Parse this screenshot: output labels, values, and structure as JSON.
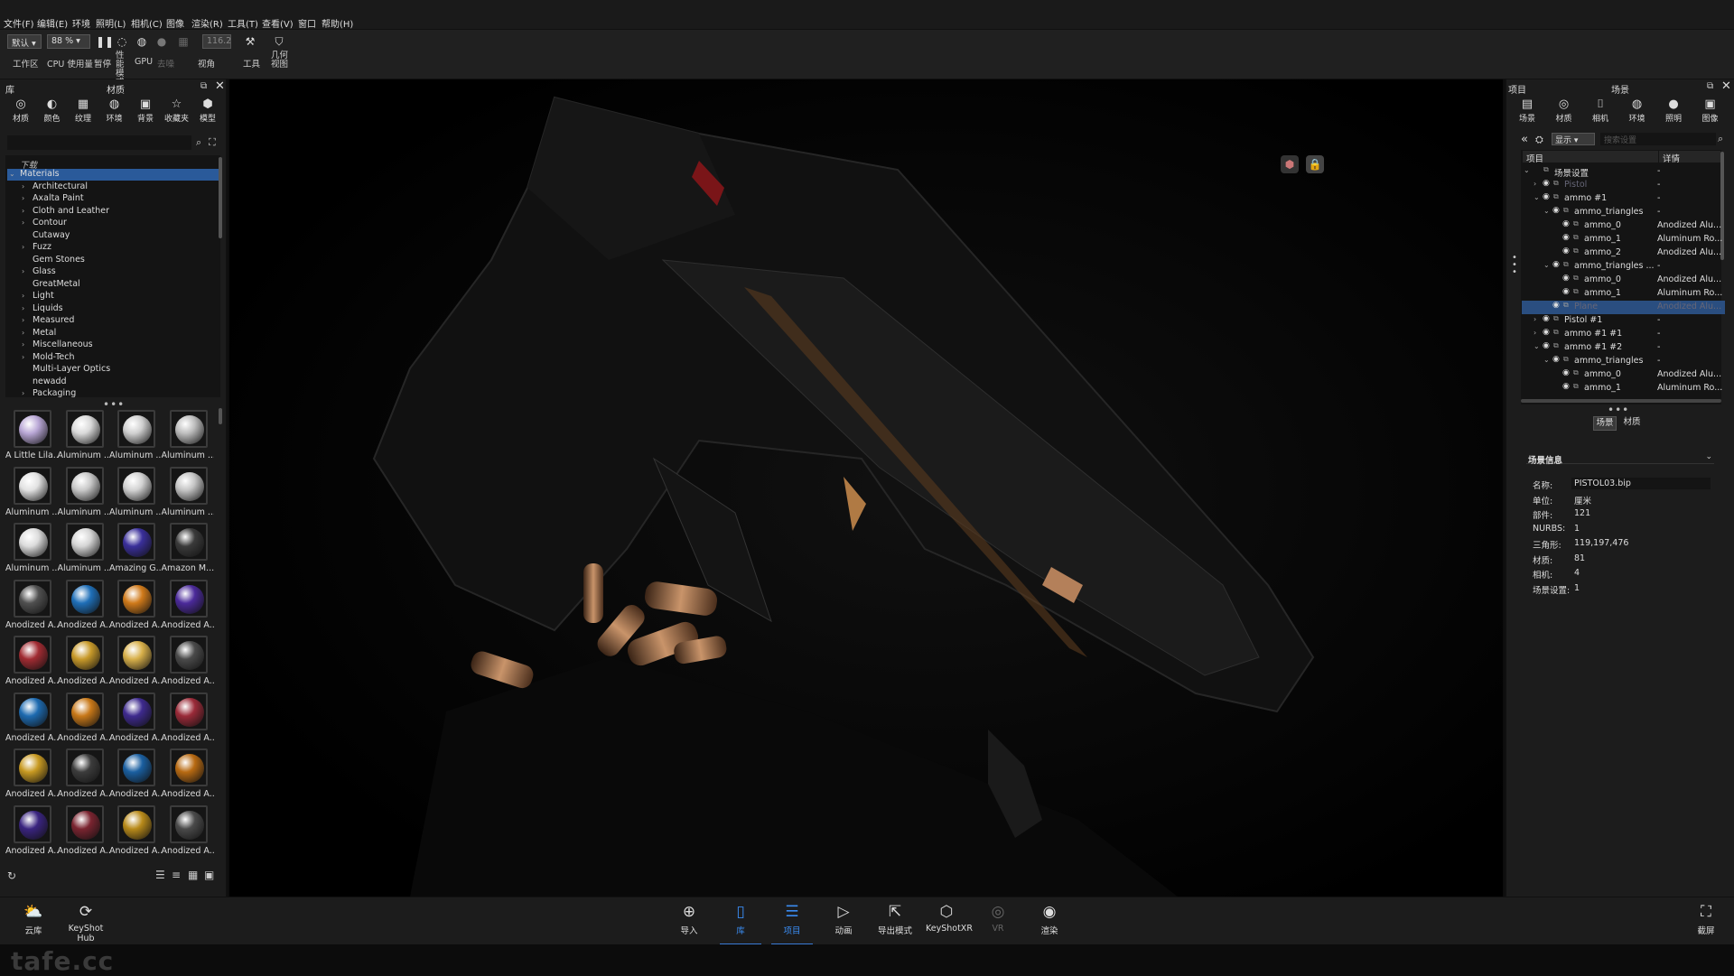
{
  "menu": [
    "文件(F)",
    "编辑(E)",
    "环境",
    "照明(L)",
    "相机(C)",
    "图像",
    "渲染(R)",
    "工具(T)",
    "查看(V)",
    "窗口",
    "帮助(H)"
  ],
  "toolbar": {
    "workspace_value": "默认",
    "zoom_value": "88 %",
    "render_value": "116.2",
    "labels": {
      "workspace": "工作区",
      "cpu": "CPU 使用量",
      "pause": "暂停",
      "perf": "性能模式",
      "gpu": "GPU",
      "denoise": "去噪",
      "view": "视角",
      "tools": "工具",
      "geometry": "几何视图"
    }
  },
  "library": {
    "title_left": "库",
    "title": "材质",
    "tabs": [
      "材质",
      "颜色",
      "纹理",
      "环境",
      "背景",
      "收藏夹",
      "模型"
    ],
    "tabs_icons": [
      "material-icon",
      "color-icon",
      "texture-icon",
      "environment-icon",
      "background-icon",
      "favorites-icon",
      "model-icon"
    ],
    "tree_header": "下载",
    "tree": [
      {
        "label": "Materials",
        "arrow": "v",
        "indent": 0,
        "selected": true
      },
      {
        "label": "Architectural",
        "arrow": ">",
        "indent": 1
      },
      {
        "label": "Axalta Paint",
        "arrow": ">",
        "indent": 1
      },
      {
        "label": "Cloth and Leather",
        "arrow": ">",
        "indent": 1
      },
      {
        "label": "Contour",
        "arrow": ">",
        "indent": 1
      },
      {
        "label": "Cutaway",
        "arrow": "",
        "indent": 1
      },
      {
        "label": "Fuzz",
        "arrow": ">",
        "indent": 1
      },
      {
        "label": "Gem Stones",
        "arrow": "",
        "indent": 1
      },
      {
        "label": "Glass",
        "arrow": ">",
        "indent": 1
      },
      {
        "label": "GreatMetal",
        "arrow": "",
        "indent": 1
      },
      {
        "label": "Light",
        "arrow": ">",
        "indent": 1
      },
      {
        "label": "Liquids",
        "arrow": ">",
        "indent": 1
      },
      {
        "label": "Measured",
        "arrow": ">",
        "indent": 1
      },
      {
        "label": "Metal",
        "arrow": ">",
        "indent": 1
      },
      {
        "label": "Miscellaneous",
        "arrow": ">",
        "indent": 1
      },
      {
        "label": "Mold-Tech",
        "arrow": ">",
        "indent": 1
      },
      {
        "label": "Multi-Layer Optics",
        "arrow": "",
        "indent": 1
      },
      {
        "label": "newadd",
        "arrow": "",
        "indent": 1
      },
      {
        "label": "Packaging",
        "arrow": ">",
        "indent": 1
      }
    ],
    "materials": [
      {
        "label": "A Little Lila...",
        "color": "#b9a7d6"
      },
      {
        "label": "Aluminum ...",
        "color": "#d9d9d9"
      },
      {
        "label": "Aluminum ...",
        "color": "#cfcfcf"
      },
      {
        "label": "Aluminum ...",
        "color": "#bdbdbd"
      },
      {
        "label": "Aluminum ...",
        "color": "#e2e2e2"
      },
      {
        "label": "Aluminum ...",
        "color": "#c8c8c8"
      },
      {
        "label": "Aluminum ...",
        "color": "#d2d2d2"
      },
      {
        "label": "Aluminum ...",
        "color": "#c4c4c4"
      },
      {
        "label": "Aluminum ...",
        "color": "#dcdcdc"
      },
      {
        "label": "Aluminum ...",
        "color": "#d5d5d5"
      },
      {
        "label": "Amazing G...",
        "color": "#3a2f9a"
      },
      {
        "label": "Amazon M...",
        "color": "#3a3a3a"
      },
      {
        "label": "Anodized A...",
        "color": "#505050"
      },
      {
        "label": "Anodized A...",
        "color": "#1f6fb8"
      },
      {
        "label": "Anodized A...",
        "color": "#d07a1a"
      },
      {
        "label": "Anodized A...",
        "color": "#4b2a9a"
      },
      {
        "label": "Anodized A...",
        "color": "#a12b32"
      },
      {
        "label": "Anodized A...",
        "color": "#c89a2a"
      },
      {
        "label": "Anodized A...",
        "color": "#d8b04a"
      },
      {
        "label": "Anodized A...",
        "color": "#4a4a4a"
      },
      {
        "label": "Anodized A...",
        "color": "#1d6ab0"
      },
      {
        "label": "Anodized A...",
        "color": "#c87818"
      },
      {
        "label": "Anodized A...",
        "color": "#3e2a8e"
      },
      {
        "label": "Anodized A...",
        "color": "#9a2a38"
      },
      {
        "label": "Anodized A...",
        "color": "#c89a22"
      },
      {
        "label": "Anodized A...",
        "color": "#3c3c3c"
      },
      {
        "label": "Anodized A...",
        "color": "#1a5fa0"
      },
      {
        "label": "Anodized A...",
        "color": "#b86a12"
      },
      {
        "label": "Anodized A...",
        "color": "#3a2480"
      },
      {
        "label": "Anodized A...",
        "color": "#7a2430"
      },
      {
        "label": "Anodized A...",
        "color": "#b88a1a"
      },
      {
        "label": "Anodized A...",
        "color": "#4a4a4a"
      }
    ]
  },
  "project": {
    "title_left": "项目",
    "title": "场景",
    "tabs": [
      "场景",
      "材质",
      "相机",
      "环境",
      "照明",
      "图像"
    ],
    "tabs_icons": [
      "scene-icon",
      "material-icon",
      "camera-icon",
      "environment-icon",
      "lighting-icon",
      "image-icon"
    ],
    "filter_value": "显示",
    "search_placeholder": "搜索设置",
    "columns": [
      "项目",
      "详情"
    ],
    "tree": [
      {
        "label": "场景设置",
        "detail": "-",
        "indent": 0,
        "arrow": "v",
        "eye": false
      },
      {
        "label": "Pistol",
        "detail": "-",
        "indent": 1,
        "arrow": ">",
        "eye": true,
        "dim": true
      },
      {
        "label": "ammo #1",
        "detail": "-",
        "indent": 1,
        "arrow": "v",
        "eye": true
      },
      {
        "label": "ammo_triangles",
        "detail": "-",
        "indent": 2,
        "arrow": "v",
        "eye": true
      },
      {
        "label": "ammo_0",
        "detail": "Anodized Alu...",
        "indent": 3,
        "arrow": "",
        "eye": true
      },
      {
        "label": "ammo_1",
        "detail": "Aluminum Ro...",
        "indent": 3,
        "arrow": "",
        "eye": true
      },
      {
        "label": "ammo_2",
        "detail": "Anodized Alu...",
        "indent": 3,
        "arrow": "",
        "eye": true
      },
      {
        "label": "ammo_triangles ...",
        "detail": "-",
        "indent": 2,
        "arrow": "v",
        "eye": true
      },
      {
        "label": "ammo_0",
        "detail": "Anodized Alu...",
        "indent": 3,
        "arrow": "",
        "eye": true
      },
      {
        "label": "ammo_1",
        "detail": "Aluminum Ro...",
        "indent": 3,
        "arrow": "",
        "eye": true
      },
      {
        "label": "Plane",
        "detail": "Anodized Alu...",
        "indent": 2,
        "arrow": "",
        "eye": true,
        "selected": true
      },
      {
        "label": "Pistol #1",
        "detail": "-",
        "indent": 1,
        "arrow": ">",
        "eye": true
      },
      {
        "label": "ammo #1 #1",
        "detail": "-",
        "indent": 1,
        "arrow": ">",
        "eye": true
      },
      {
        "label": "ammo #1 #2",
        "detail": "-",
        "indent": 1,
        "arrow": "v",
        "eye": true
      },
      {
        "label": "ammo_triangles",
        "detail": "-",
        "indent": 2,
        "arrow": "v",
        "eye": true
      },
      {
        "label": "ammo_0",
        "detail": "Anodized Alu...",
        "indent": 3,
        "arrow": "",
        "eye": true
      },
      {
        "label": "ammo_1",
        "detail": "Aluminum Ro...",
        "indent": 3,
        "arrow": "",
        "eye": true
      }
    ],
    "subtabs": [
      "场景",
      "材质"
    ],
    "info_title": "场景信息",
    "info": [
      {
        "k": "名称:",
        "v": "PISTOL03.bip"
      },
      {
        "k": "单位:",
        "v": "厘米"
      },
      {
        "k": "部件:",
        "v": "121"
      },
      {
        "k": "NURBS:",
        "v": "1"
      },
      {
        "k": "三角形:",
        "v": "119,197,476"
      },
      {
        "k": "材质:",
        "v": "81"
      },
      {
        "k": "相机:",
        "v": "4"
      },
      {
        "k": "场景设置:",
        "v": "1"
      }
    ]
  },
  "bottom": {
    "left": [
      {
        "label": "云库",
        "icon": "cloud-library-icon"
      },
      {
        "label": "KeyShot Hub",
        "icon": "keyshot-hub-icon"
      }
    ],
    "center": [
      {
        "label": "导入",
        "icon": "import-icon",
        "glyph": "⊕"
      },
      {
        "label": "库",
        "icon": "library-icon",
        "glyph": "▯",
        "active": true
      },
      {
        "label": "项目",
        "icon": "project-icon",
        "glyph": "☰",
        "active": true
      },
      {
        "label": "动画",
        "icon": "animation-icon",
        "glyph": "▷"
      },
      {
        "label": "导出模式",
        "icon": "export-icon",
        "glyph": "⇱"
      },
      {
        "label": "KeyShotXR",
        "icon": "keyshotxr-icon",
        "glyph": "⬡"
      },
      {
        "label": "VR",
        "icon": "vr-icon",
        "glyph": "◎",
        "disabled": true
      },
      {
        "label": "渲染",
        "icon": "render-icon",
        "glyph": "◉"
      }
    ],
    "right": {
      "label": "截屏",
      "icon": "screenshot-icon"
    }
  },
  "watermark": "tafe.cc"
}
